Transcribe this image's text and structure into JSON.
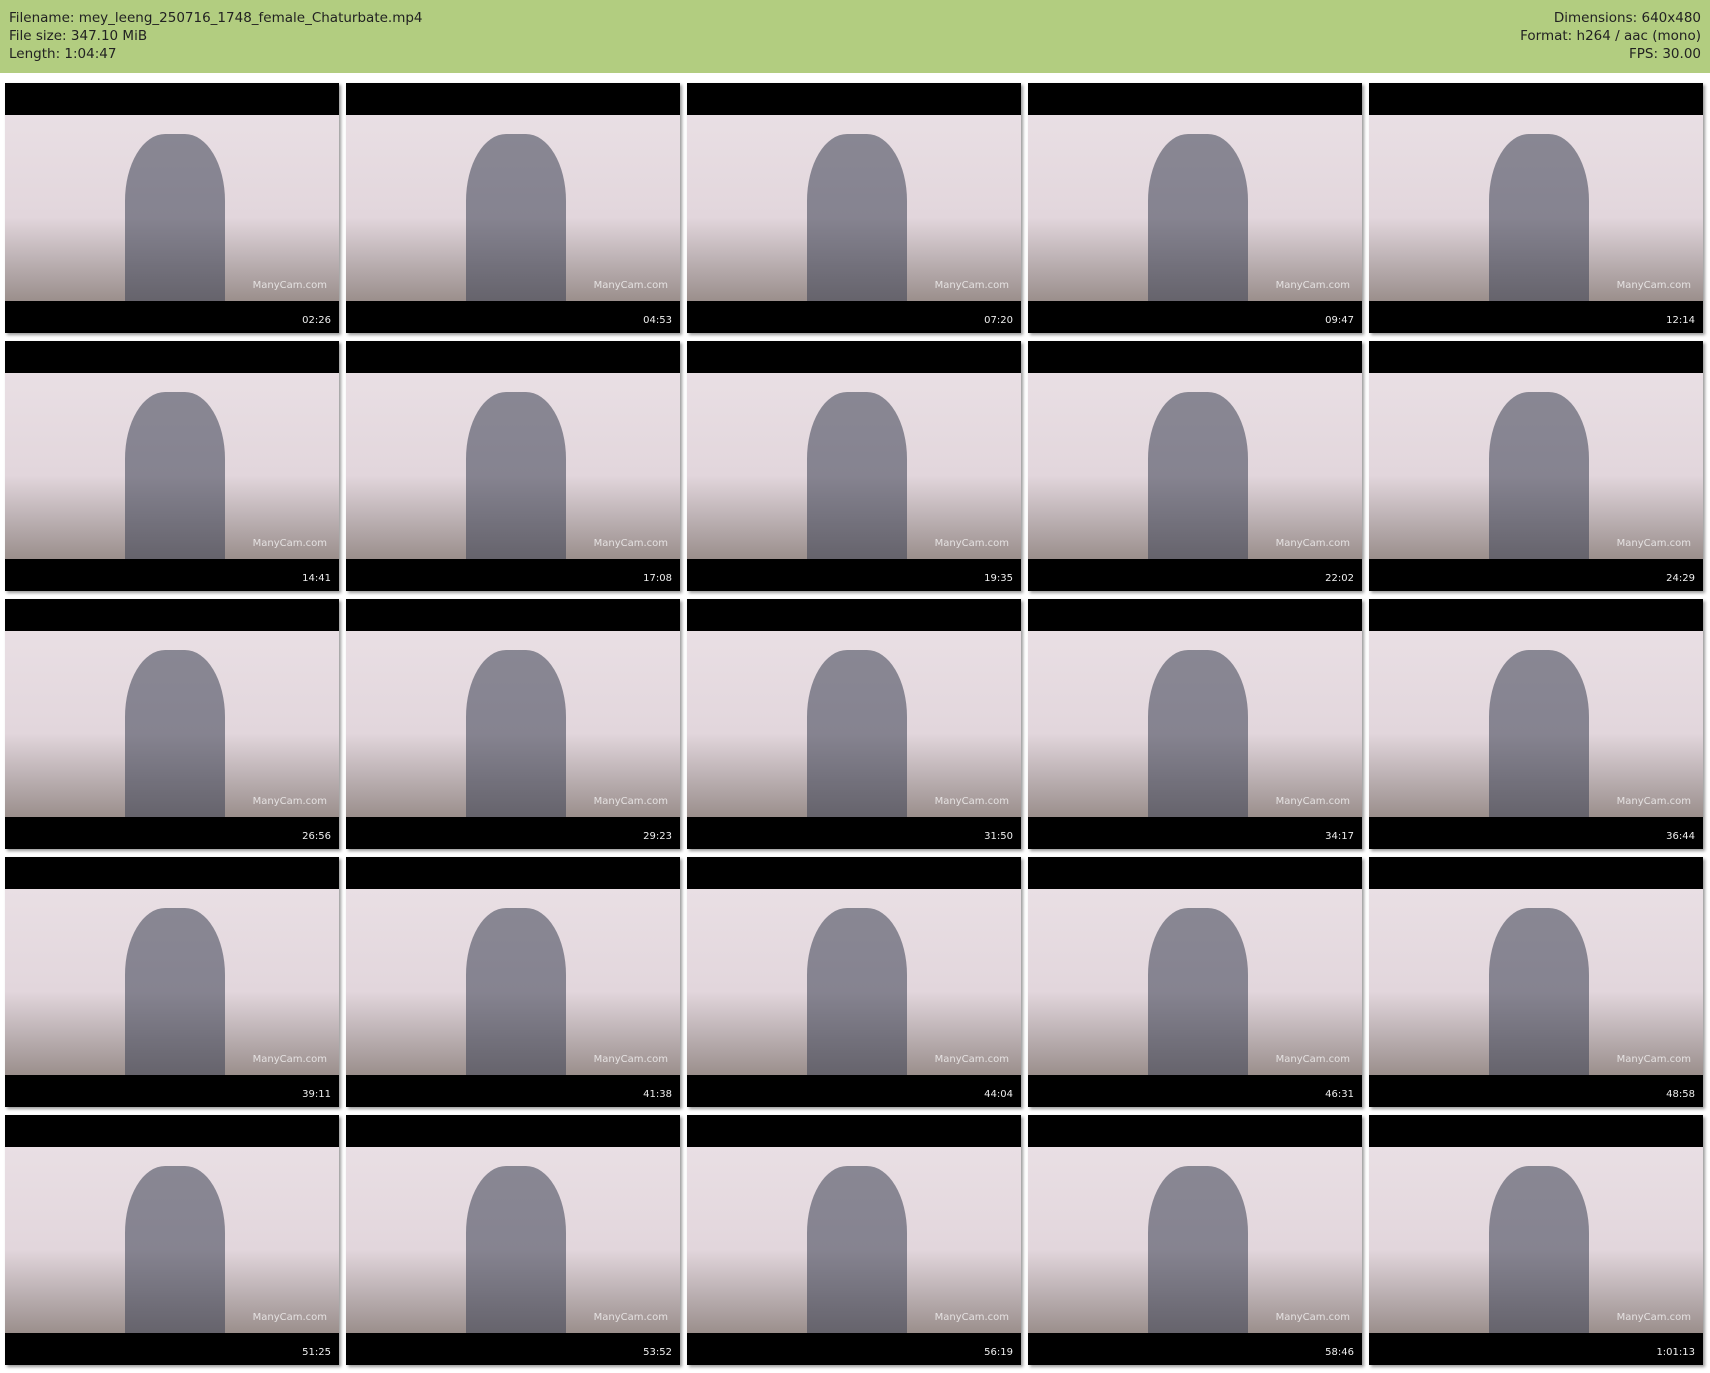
{
  "header": {
    "filename": "Filename: mey_leeng_250716_1748_female_Chaturbate.mp4",
    "filesize": "File size: 347.10 MiB",
    "length": "Length: 1:04:47",
    "dimensions": "Dimensions: 640x480",
    "format": "Format: h264 / aac (mono)",
    "fps": "FPS: 30.00"
  },
  "watermark": "ManyCam.com",
  "thumbnails": [
    "02:26",
    "04:53",
    "07:20",
    "09:47",
    "12:14",
    "14:41",
    "17:08",
    "19:35",
    "22:02",
    "24:29",
    "26:56",
    "29:23",
    "31:50",
    "34:17",
    "36:44",
    "39:11",
    "41:38",
    "44:04",
    "46:31",
    "48:58",
    "51:25",
    "53:52",
    "56:19",
    "58:46",
    "1:01:13"
  ]
}
